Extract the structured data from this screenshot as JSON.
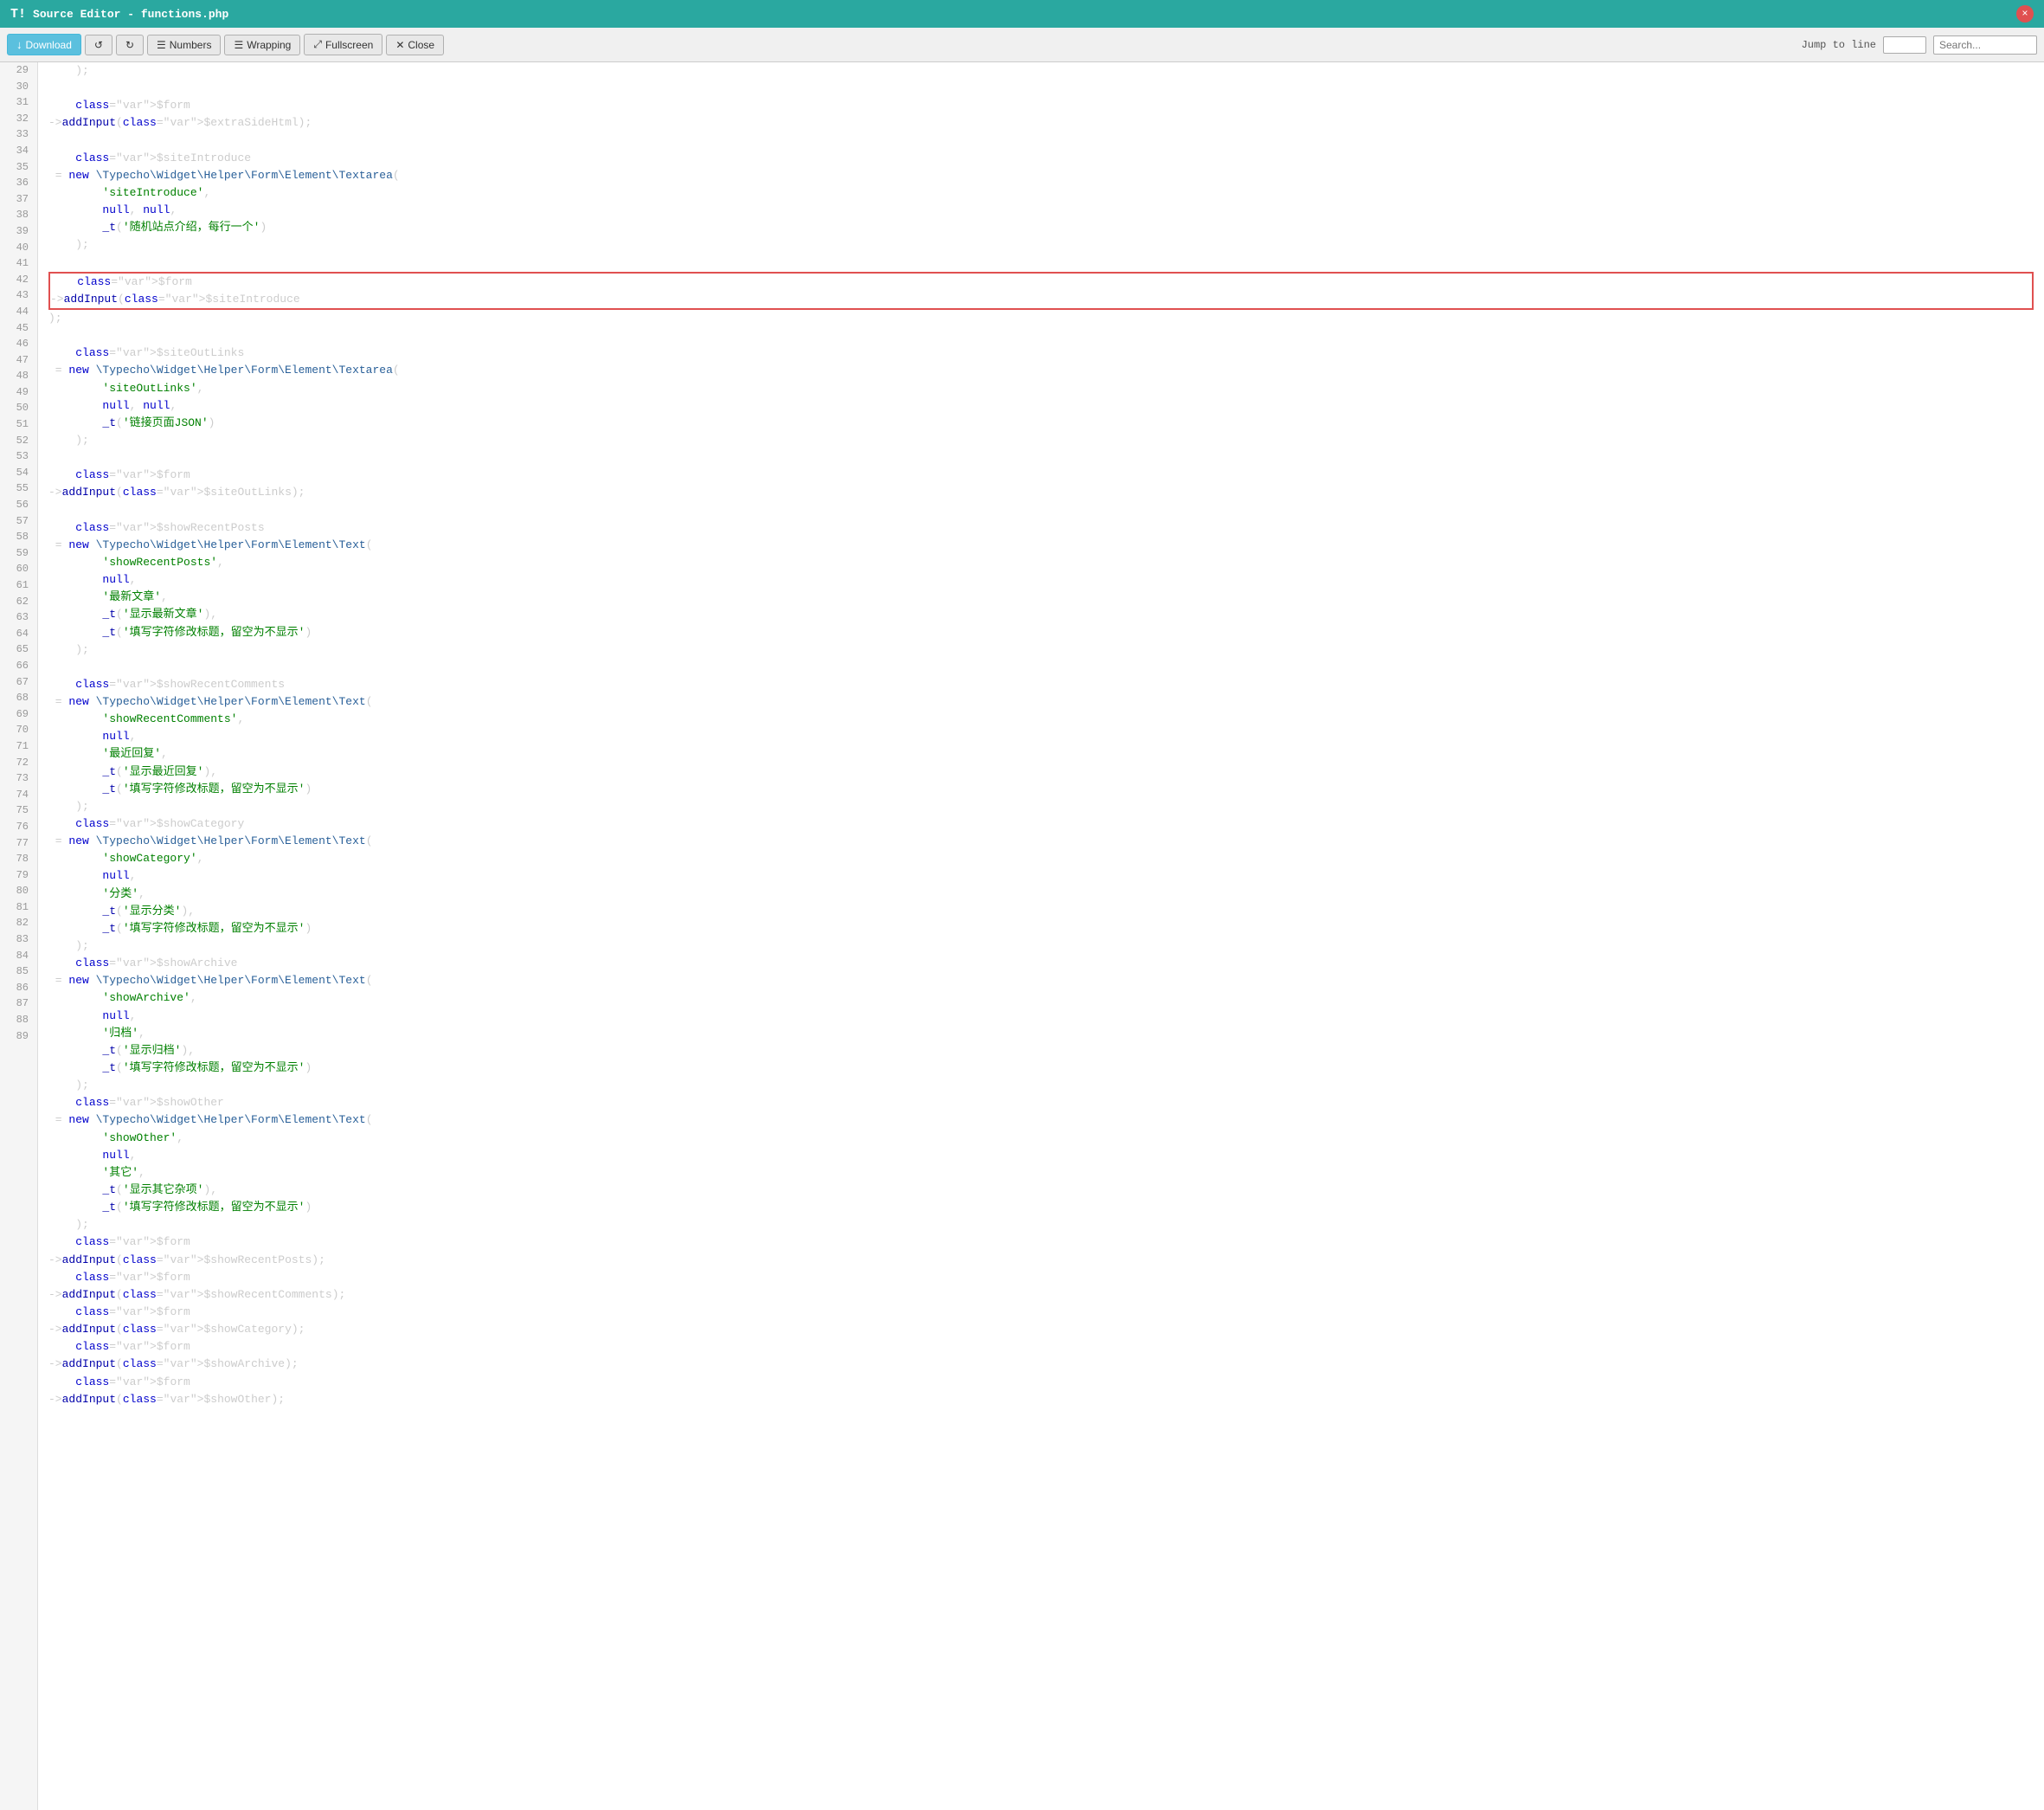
{
  "titleBar": {
    "logo": "T!",
    "title": "Source Editor - functions.php",
    "closeLabel": "×"
  },
  "toolbar": {
    "downloadLabel": "Download",
    "downloadIcon": "↓",
    "undoIcon": "↺",
    "redoIcon": "↻",
    "numbersLabel": "Numbers",
    "wrappingLabel": "Wrapping",
    "fullscreenLabel": "Fullscreen",
    "closeLabel": "Close",
    "jumpToLineLabel": "Jump to line",
    "searchPlaceholder": "Search..."
  },
  "lines": [
    {
      "n": 29,
      "code": "    );\n"
    },
    {
      "n": 30,
      "code": "\n"
    },
    {
      "n": 31,
      "code": "    $form->addInput($extraSideHtml);\n"
    },
    {
      "n": 32,
      "code": "\n"
    },
    {
      "n": 33,
      "code": "    $siteIntroduce = new \\Typecho\\Widget\\Helper\\Form\\Element\\Textarea(\n"
    },
    {
      "n": 34,
      "code": "        'siteIntroduce',\n"
    },
    {
      "n": 35,
      "code": "        null, null,\n"
    },
    {
      "n": 36,
      "code": "        _t('随机站点介绍，每行一个')\n"
    },
    {
      "n": 37,
      "code": "    );\n"
    },
    {
      "n": 38,
      "code": "\n"
    },
    {
      "n": 39,
      "code": "    $form->addInput($siteIntroduce);\n"
    },
    {
      "n": 40,
      "code": "\n"
    },
    {
      "n": 41,
      "code": "    $siteOutLinks = new \\Typecho\\Widget\\Helper\\Form\\Element\\Textarea(\n"
    },
    {
      "n": 42,
      "code": "        'siteOutLinks',\n"
    },
    {
      "n": 43,
      "code": "        null, null,\n"
    },
    {
      "n": 44,
      "code": "        _t('链接页面JSON')\n"
    },
    {
      "n": 45,
      "code": "    );\n"
    },
    {
      "n": 46,
      "code": "\n"
    },
    {
      "n": 47,
      "code": "    $form->addInput($siteOutLinks);\n"
    },
    {
      "n": 48,
      "code": "\n"
    },
    {
      "n": 49,
      "code": "    $showRecentPosts = new \\Typecho\\Widget\\Helper\\Form\\Element\\Text(\n"
    },
    {
      "n": 50,
      "code": "        'showRecentPosts',\n"
    },
    {
      "n": 51,
      "code": "        null,\n"
    },
    {
      "n": 52,
      "code": "        '最新文章',\n"
    },
    {
      "n": 53,
      "code": "        _t('显示最新文章'),\n"
    },
    {
      "n": 54,
      "code": "        _t('填写字符修改标题，留空为不显示')\n"
    },
    {
      "n": 55,
      "code": "    );\n"
    },
    {
      "n": 56,
      "code": "\n"
    },
    {
      "n": 57,
      "code": "    $showRecentComments = new \\Typecho\\Widget\\Helper\\Form\\Element\\Text(\n"
    },
    {
      "n": 58,
      "code": "        'showRecentComments',\n"
    },
    {
      "n": 59,
      "code": "        null,\n"
    },
    {
      "n": 60,
      "code": "        '最近回复',\n"
    },
    {
      "n": 61,
      "code": "        _t('显示最近回复'),\n"
    },
    {
      "n": 62,
      "code": "        _t('填写字符修改标题，留空为不显示')\n"
    },
    {
      "n": 63,
      "code": "    );\n"
    },
    {
      "n": 64,
      "code": "    $showCategory = new \\Typecho\\Widget\\Helper\\Form\\Element\\Text(\n"
    },
    {
      "n": 65,
      "code": "        'showCategory',\n"
    },
    {
      "n": 66,
      "code": "        null,\n"
    },
    {
      "n": 67,
      "code": "        '分类',\n"
    },
    {
      "n": 68,
      "code": "        _t('显示分类'),\n"
    },
    {
      "n": 69,
      "code": "        _t('填写字符修改标题，留空为不显示')\n"
    },
    {
      "n": 70,
      "code": "    );\n"
    },
    {
      "n": 71,
      "code": "    $showArchive = new \\Typecho\\Widget\\Helper\\Form\\Element\\Text(\n"
    },
    {
      "n": 72,
      "code": "        'showArchive',\n"
    },
    {
      "n": 73,
      "code": "        null,\n"
    },
    {
      "n": 74,
      "code": "        '归档',\n"
    },
    {
      "n": 75,
      "code": "        _t('显示归档'),\n"
    },
    {
      "n": 76,
      "code": "        _t('填写字符修改标题，留空为不显示')\n"
    },
    {
      "n": 77,
      "code": "    );\n"
    },
    {
      "n": 78,
      "code": "    $showOther = new \\Typecho\\Widget\\Helper\\Form\\Element\\Text(\n"
    },
    {
      "n": 79,
      "code": "        'showOther',\n"
    },
    {
      "n": 80,
      "code": "        null,\n"
    },
    {
      "n": 81,
      "code": "        '其它',\n"
    },
    {
      "n": 82,
      "code": "        _t('显示其它杂项'),\n"
    },
    {
      "n": 83,
      "code": "        _t('填写字符修改标题，留空为不显示')\n"
    },
    {
      "n": 84,
      "code": "    );\n"
    },
    {
      "n": 85,
      "code": "    $form->addInput($showRecentPosts);\n"
    },
    {
      "n": 86,
      "code": "    $form->addInput($showRecentComments);\n"
    },
    {
      "n": 87,
      "code": "    $form->addInput($showCategory);\n"
    },
    {
      "n": 88,
      "code": "    $form->addInput($showArchive);\n"
    },
    {
      "n": 89,
      "code": "    $form->addInput($showOther);\n"
    }
  ],
  "highlightRange": {
    "start": 39,
    "end": 45
  }
}
